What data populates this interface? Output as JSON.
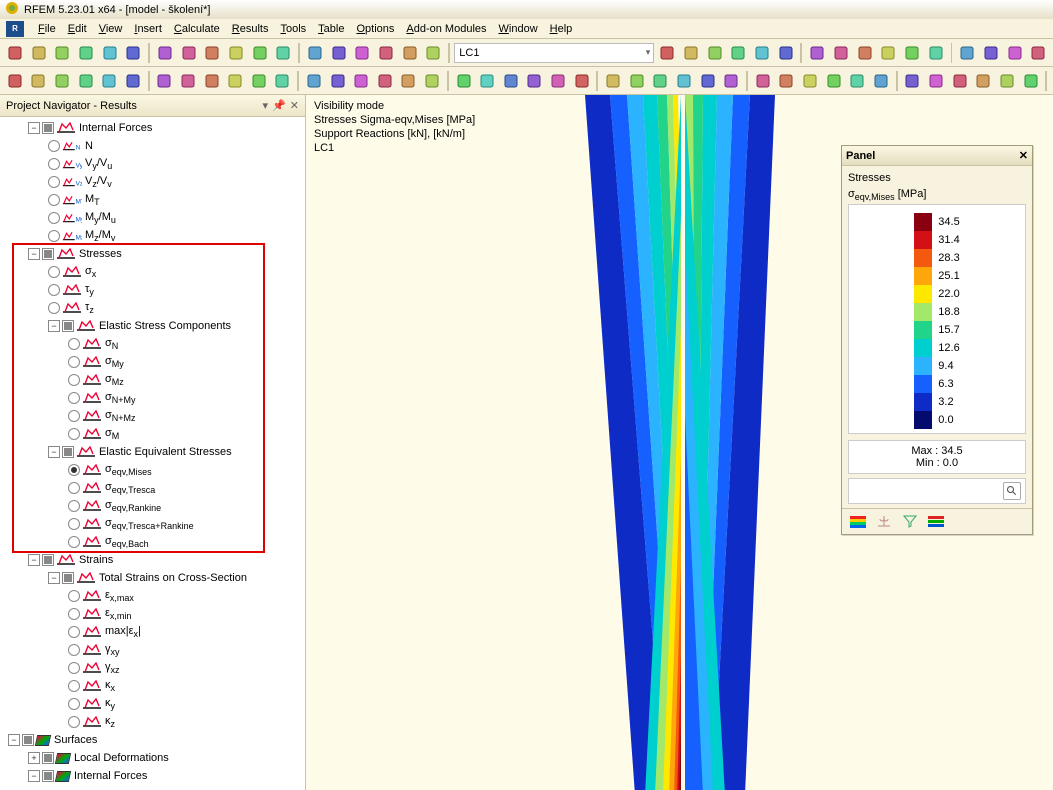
{
  "title": "RFEM 5.23.01 x64 - [model - školení*]",
  "menu": [
    "File",
    "Edit",
    "View",
    "Insert",
    "Calculate",
    "Results",
    "Tools",
    "Table",
    "Options",
    "Add-on Modules",
    "Window",
    "Help"
  ],
  "lc_dropdown": "LC1",
  "navigator_title": "Project Navigator - Results",
  "viewport_info": [
    "Visibility mode",
    "Stresses Sigma-eqv,Mises [MPa]",
    "Support Reactions [kN], [kN/m]",
    "LC1"
  ],
  "panel": {
    "title": "Panel",
    "sub1": "Stresses",
    "sub2_prefix": "σ",
    "sub2_sub": "eqv,Mises",
    "sub2_unit": " [MPa]",
    "max_label": "Max  :  ",
    "max_val": "34.5",
    "min_label": "Min   :   ",
    "min_val": "0.0"
  },
  "legend": {
    "colors": [
      "#8a0010",
      "#d31016",
      "#f45a0f",
      "#ffa60a",
      "#ffe800",
      "#a2e86b",
      "#22d489",
      "#00cfcf",
      "#2cb3ff",
      "#1560ff",
      "#0f2bc5",
      "#040b6d"
    ],
    "values": [
      "34.5",
      "31.4",
      "28.3",
      "25.1",
      "22.0",
      "18.8",
      "15.7",
      "12.6",
      "9.4",
      "6.3",
      "3.2",
      "0.0"
    ]
  },
  "tree": [
    {
      "d": 1,
      "t": "group",
      "ex": "-",
      "ck": "p",
      "k": "beam",
      "label": "Internal Forces"
    },
    {
      "d": 2,
      "t": "radio",
      "k": "beam2",
      "html": "N",
      "sub": "N"
    },
    {
      "d": 2,
      "t": "radio",
      "k": "beam2",
      "html": "V",
      "sub": "Vy",
      "lab": "Vy/Vu"
    },
    {
      "d": 2,
      "t": "radio",
      "k": "beam2",
      "html": "V",
      "sub": "Vz",
      "lab": "Vz/Vv"
    },
    {
      "d": 2,
      "t": "radio",
      "k": "beam2",
      "html": "M",
      "sub": "MT",
      "lab": "MT"
    },
    {
      "d": 2,
      "t": "radio",
      "k": "beam2",
      "html": "M",
      "sub": "My",
      "lab": "My/Mu"
    },
    {
      "d": 2,
      "t": "radio",
      "k": "beam2",
      "html": "M",
      "sub": "Mz",
      "lab": "Mz/Mv"
    },
    {
      "d": 1,
      "t": "group",
      "ex": "-",
      "ck": "p",
      "k": "beam",
      "label": "Stresses",
      "hl": true,
      "hl_start": true
    },
    {
      "d": 2,
      "t": "radio",
      "k": "beam",
      "html": "σx"
    },
    {
      "d": 2,
      "t": "radio",
      "k": "beam",
      "html": "τy"
    },
    {
      "d": 2,
      "t": "radio",
      "k": "beam",
      "html": "τz"
    },
    {
      "d": 2,
      "t": "group",
      "ex": "-",
      "ck": "p",
      "k": "beam",
      "label": "Elastic Stress Components",
      "hl": true
    },
    {
      "d": 3,
      "t": "radio",
      "k": "beam",
      "html": "σN"
    },
    {
      "d": 3,
      "t": "radio",
      "k": "beam",
      "html": "σMy"
    },
    {
      "d": 3,
      "t": "radio",
      "k": "beam",
      "html": "σMz"
    },
    {
      "d": 3,
      "t": "radio",
      "k": "beam",
      "html": "σN+My"
    },
    {
      "d": 3,
      "t": "radio",
      "k": "beam",
      "html": "σN+Mz"
    },
    {
      "d": 3,
      "t": "radio",
      "k": "beam",
      "html": "σM"
    },
    {
      "d": 2,
      "t": "group",
      "ex": "-",
      "ck": "p",
      "k": "beam",
      "label": "Elastic Equivalent Stresses",
      "hl": true
    },
    {
      "d": 3,
      "t": "radio",
      "sel": true,
      "k": "beam",
      "html": "σeqv,Mises"
    },
    {
      "d": 3,
      "t": "radio",
      "k": "beam",
      "html": "σeqv,Tresca"
    },
    {
      "d": 3,
      "t": "radio",
      "k": "beam",
      "html": "σeqv,Rankine"
    },
    {
      "d": 3,
      "t": "radio",
      "k": "beam",
      "html": "σeqv,Tresca+Rankine"
    },
    {
      "d": 3,
      "t": "radio",
      "k": "beam",
      "html": "σeqv,Bach",
      "hl_end": true
    },
    {
      "d": 1,
      "t": "group",
      "ex": "-",
      "ck": "p",
      "k": "beam",
      "label": "Strains"
    },
    {
      "d": 2,
      "t": "group",
      "ex": "-",
      "ck": "p",
      "k": "beam",
      "label": "Total Strains on Cross-Section"
    },
    {
      "d": 3,
      "t": "radio",
      "k": "beam",
      "html": "εx,max"
    },
    {
      "d": 3,
      "t": "radio",
      "k": "beam",
      "html": "εx,min"
    },
    {
      "d": 3,
      "t": "radio",
      "k": "beam",
      "html": "max|εx|"
    },
    {
      "d": 3,
      "t": "radio",
      "k": "beam",
      "html": "γxy"
    },
    {
      "d": 3,
      "t": "radio",
      "k": "beam",
      "html": "γxz"
    },
    {
      "d": 3,
      "t": "radio",
      "k": "beam",
      "html": "κx"
    },
    {
      "d": 3,
      "t": "radio",
      "k": "beam",
      "html": "κy"
    },
    {
      "d": 3,
      "t": "radio",
      "k": "beam",
      "html": "κz"
    },
    {
      "d": 0,
      "t": "group",
      "ex": "-",
      "ck": "p",
      "k": "surf",
      "label": "Surfaces"
    },
    {
      "d": 1,
      "t": "group",
      "ex": "+",
      "ck": "p",
      "k": "surf",
      "label": "Local Deformations"
    },
    {
      "d": 1,
      "t": "group",
      "ex": "-",
      "ck": "p",
      "k": "surf",
      "label": "Internal Forces"
    }
  ]
}
